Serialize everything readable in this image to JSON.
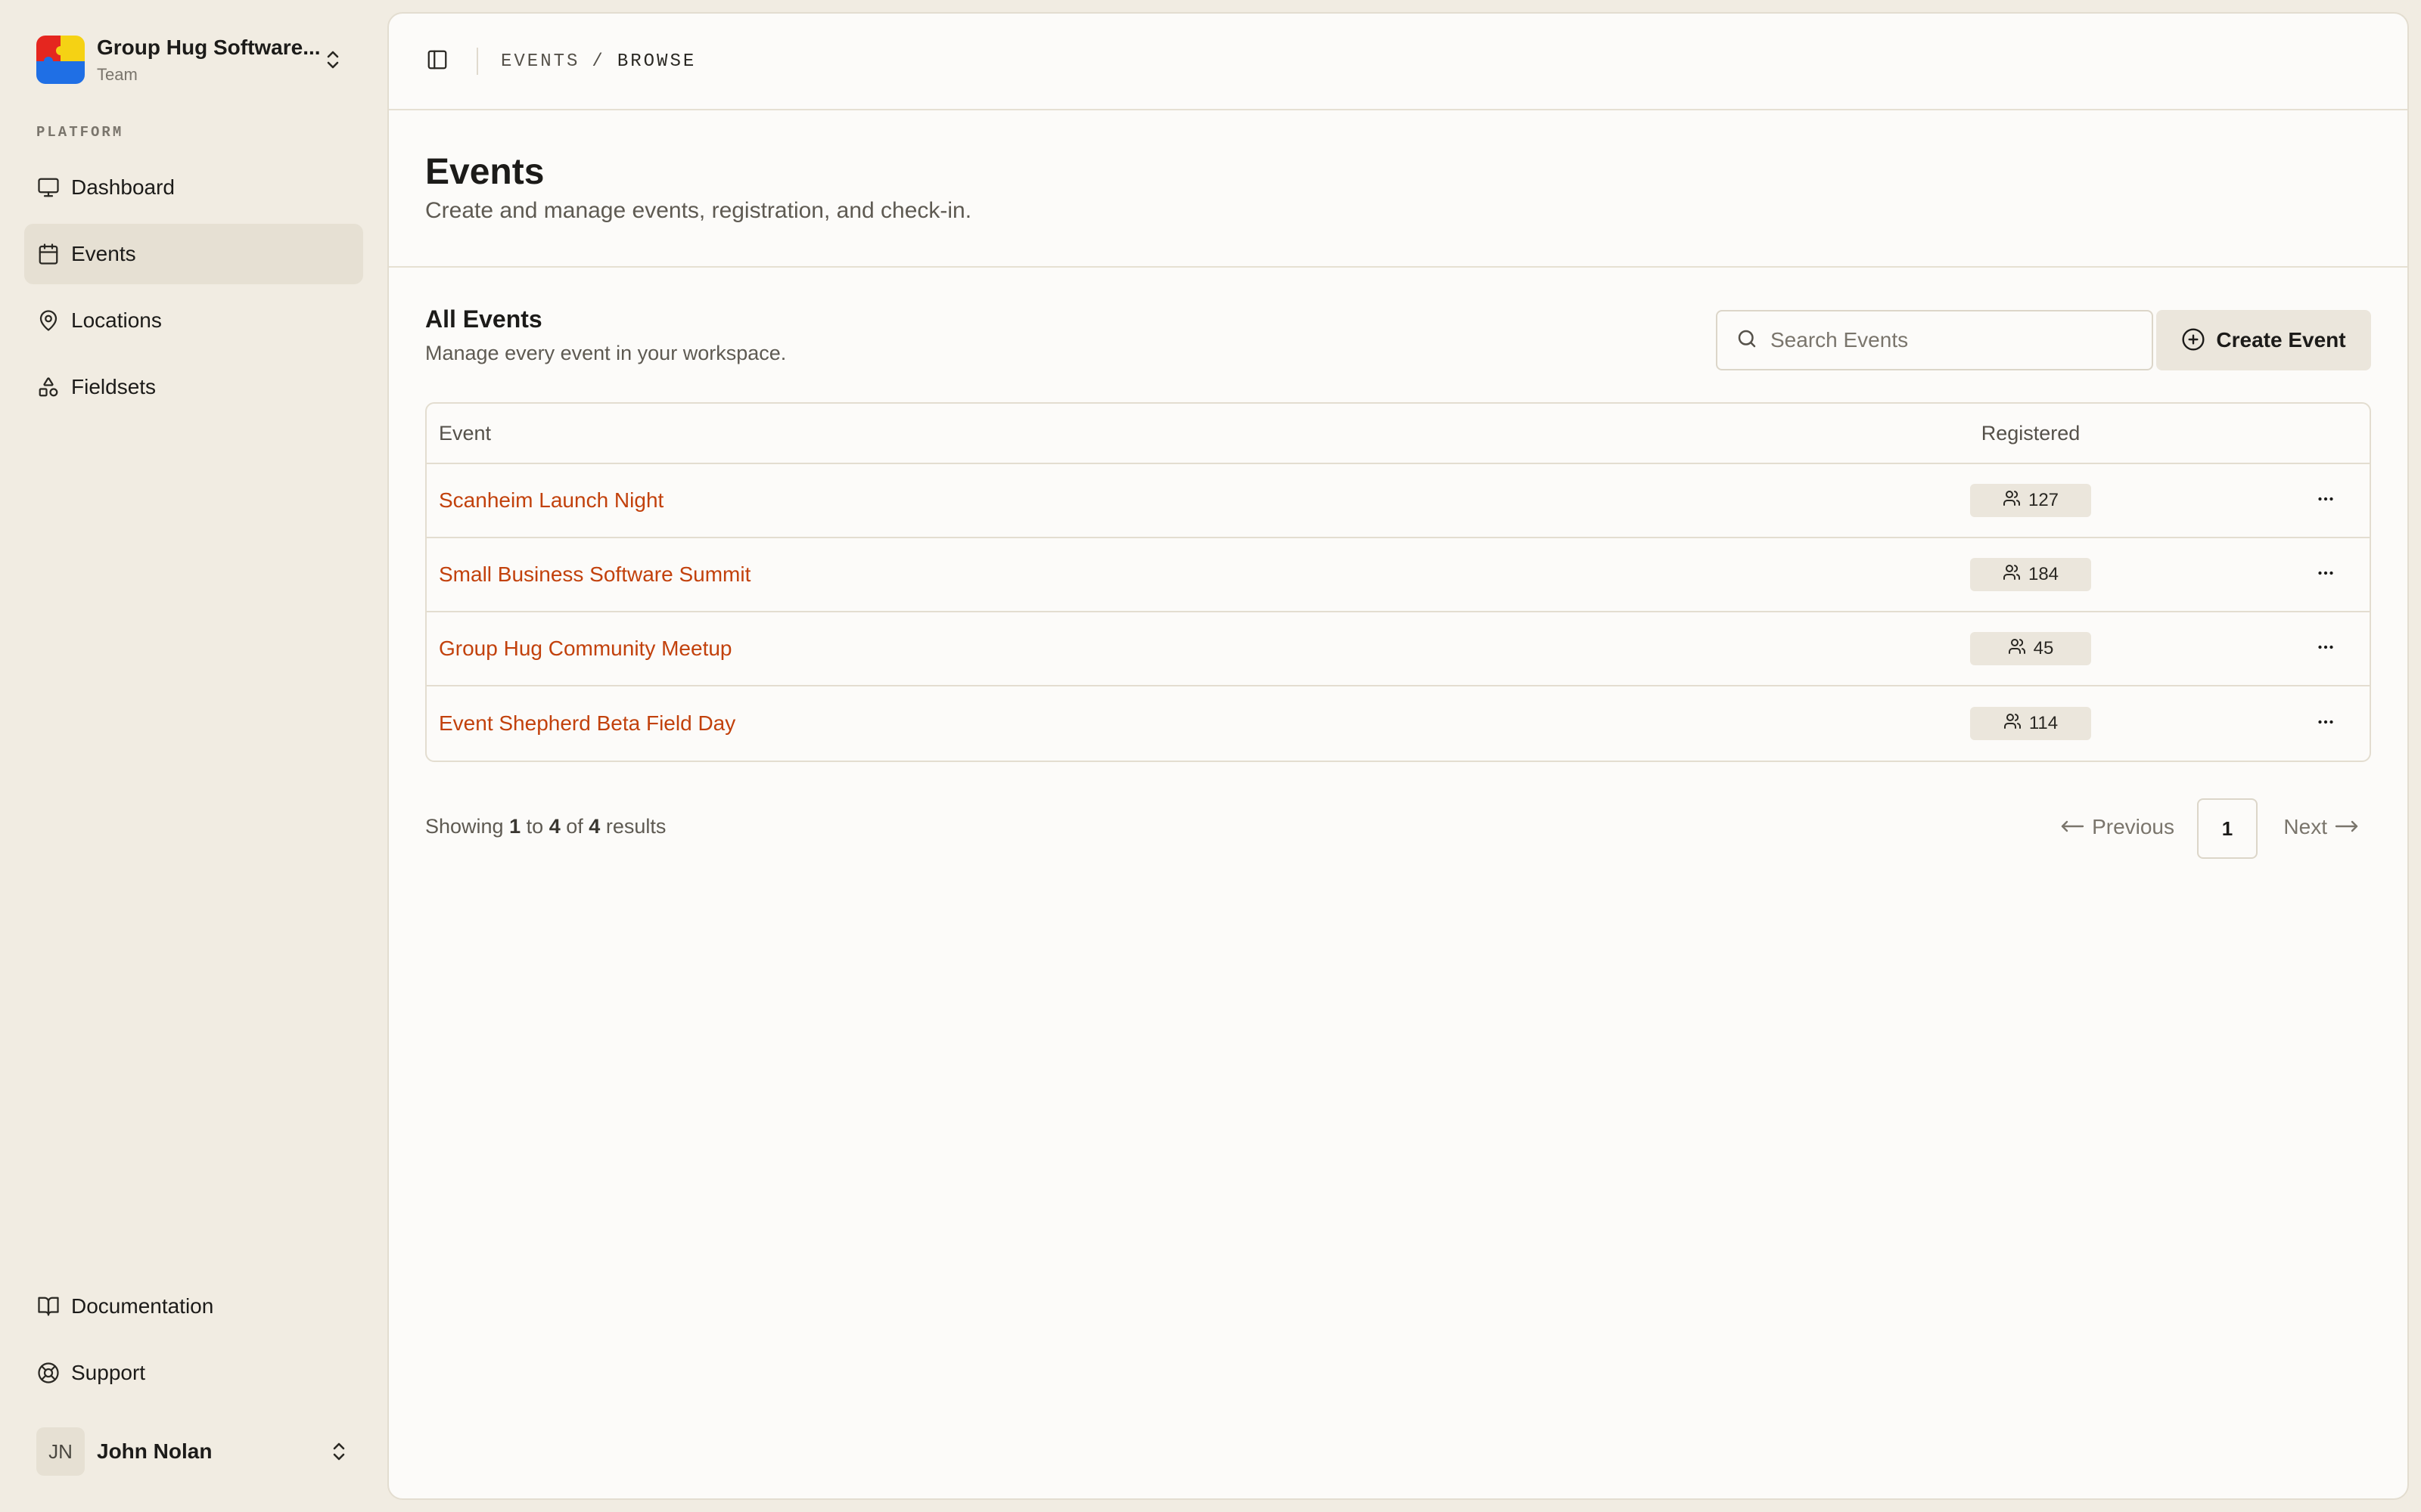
{
  "team": {
    "name": "Group Hug Software...",
    "plan": "Team"
  },
  "sidebar": {
    "section_label": "PLATFORM",
    "items": [
      {
        "label": "Dashboard",
        "icon": "monitor-icon",
        "active": false
      },
      {
        "label": "Events",
        "icon": "calendar-icon",
        "active": true
      },
      {
        "label": "Locations",
        "icon": "map-pin-icon",
        "active": false
      },
      {
        "label": "Fieldsets",
        "icon": "shapes-icon",
        "active": false
      }
    ],
    "bottom_items": [
      {
        "label": "Documentation",
        "icon": "book-icon"
      },
      {
        "label": "Support",
        "icon": "life-buoy-icon"
      }
    ]
  },
  "user": {
    "initials": "JN",
    "name": "John Nolan"
  },
  "breadcrumb": {
    "parent": "EVENTS",
    "separator": "/",
    "current": "BROWSE"
  },
  "page": {
    "title": "Events",
    "subtitle": "Create and manage events, registration, and check-in."
  },
  "events_section": {
    "title": "All Events",
    "description": "Manage every event in your workspace.",
    "search_placeholder": "Search Events",
    "create_label": "Create Event"
  },
  "table": {
    "columns": {
      "event": "Event",
      "registered": "Registered"
    },
    "rows": [
      {
        "name": "Scanheim Launch Night",
        "registered": "127"
      },
      {
        "name": "Small Business Software Summit",
        "registered": "184"
      },
      {
        "name": "Group Hug Community Meetup",
        "registered": "45"
      },
      {
        "name": "Event Shepherd Beta Field Day",
        "registered": "114"
      }
    ]
  },
  "pagination": {
    "showing_prefix": "Showing",
    "from": "1",
    "to_word": "to",
    "to": "4",
    "of_word": "of",
    "total": "4",
    "results_word": "results",
    "previous_label": "Previous",
    "next_label": "Next",
    "current_page": "1"
  },
  "colors": {
    "accent_link": "#c2410c",
    "sidebar_bg": "#f1ece2",
    "panel_bg": "#fcfbf9",
    "active_item_bg": "#e6e0d3"
  }
}
